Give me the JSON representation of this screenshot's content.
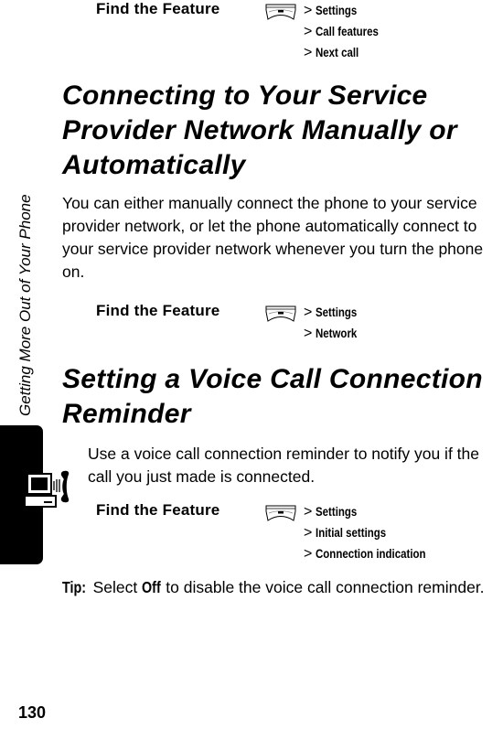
{
  "sidebar": {
    "chapter_title": "Getting More Out of Your Phone",
    "tab_icon": "computer-phone-icon"
  },
  "colors": {
    "text": "#000000",
    "background": "#ffffff",
    "tab": "#000000"
  },
  "sections": [
    {
      "find_feature": {
        "label": "Find the Feature",
        "key_icon": "menu-key-icon",
        "separator": ">",
        "path": [
          "Settings",
          "Call features",
          "Next call"
        ]
      }
    },
    {
      "heading": "Connecting to Your Service Provider Network Manually or Automatically",
      "body": "You can either manually connect the phone to your service provider network, or let the phone automatically connect to your service provider network whenever you turn the phone on.",
      "find_feature": {
        "label": "Find the Feature",
        "key_icon": "menu-key-icon",
        "separator": ">",
        "path": [
          "Settings",
          "Network"
        ]
      }
    },
    {
      "heading": "Setting a Voice Call Connection Reminder",
      "body": "Use a voice call connection reminder to notify you if the call you just made is connected.",
      "find_feature": {
        "label": "Find the Feature",
        "key_icon": "menu-key-icon",
        "separator": ">",
        "path": [
          "Settings",
          "Initial settings",
          "Connection indication"
        ]
      }
    }
  ],
  "tip": {
    "label": "Tip:",
    "before": " Select ",
    "term": "Off",
    "after": " to disable the voice call connection reminder."
  },
  "page_number": "130"
}
